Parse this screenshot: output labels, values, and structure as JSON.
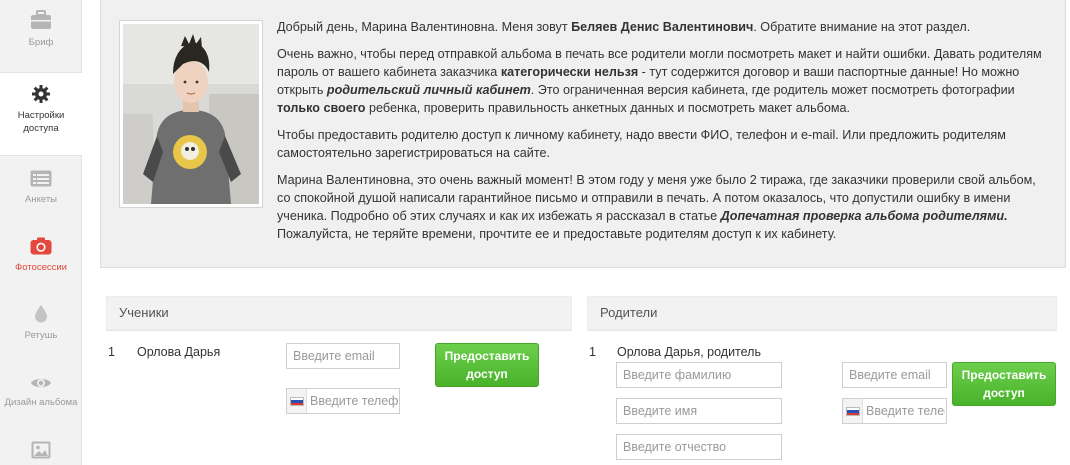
{
  "sidebar": {
    "items": [
      {
        "label": "Бриф",
        "icon": "briefcase-icon"
      },
      {
        "label": "Настройки доступа",
        "icon": "gear-icon"
      },
      {
        "label": "Анкеты",
        "icon": "list-icon"
      },
      {
        "label": "Фотосессии",
        "icon": "camera-icon"
      },
      {
        "label": "Ретушь",
        "icon": "drop-icon"
      },
      {
        "label": "Дизайн альбома",
        "icon": "eye-icon"
      },
      {
        "label": "",
        "icon": "image-icon"
      }
    ],
    "accent_color": "#e2483d"
  },
  "info": {
    "p1_a": "Добрый день, Марина Валентиновна. Меня зовут ",
    "p1_b": "Беляев Денис Валентинович",
    "p1_c": ". Обратите внимание на этот раздел.",
    "p2_a": "Очень важно, чтобы перед отправкой альбома в печать все родители могли посмотреть макет и найти ошибки. Давать родителям пароль от вашего кабинета заказчика ",
    "p2_b": "категорически нельзя",
    "p2_c": " - тут содержится договор и ваши паспортные данные! Но можно открыть ",
    "p2_d": "родительский личный кабинет",
    "p2_e": ". Это ограниченная версия кабинета, где родитель может посмотреть фотографии ",
    "p2_f": "только своего",
    "p2_g": " ребенка, проверить правильность анкетных данных и посмотреть макет альбома.",
    "p3": "Чтобы предоставить родителю доступ к личному кабинету, надо ввести ФИО, телефон и e-mail. Или предложить родителям самостоятельно зарегистрироваться на сайте.",
    "p4_a": "Марина Валентиновна, это очень важный момент! В этом году у меня уже было 2 тиража, где заказчики проверили свой альбом, со спокойной душой написали гарантийное письмо и отправили в печать. А потом оказалось, что допустили ошибку в имени ученика. Подробно об этих случаях и как их избежать я рассказал в статье ",
    "p4_b": "Допечатная проверка альбома родителями.",
    "p4_c": " Пожалуйста, не теряйте времени, прочтите ее и предоставьте родителям доступ к их кабинету."
  },
  "students": {
    "header": "Ученики",
    "rows": [
      {
        "num": "1",
        "name": "Орлова Дарья",
        "email_placeholder": "Введите email",
        "phone_placeholder": "Введите телефон",
        "button": "Предоставить доступ"
      }
    ]
  },
  "parents": {
    "header": "Родители",
    "rows": [
      {
        "num": "1",
        "name": "Орлова Дарья, родитель",
        "surname_placeholder": "Введите фамилию",
        "firstname_placeholder": "Введите имя",
        "patronymic_placeholder": "Введите отчество",
        "email_placeholder": "Введите email",
        "phone_placeholder": "Введите телефон",
        "button": "Предоставить доступ"
      }
    ]
  },
  "colors": {
    "button_green": "#52b935",
    "panel_bg": "#f0f0f0"
  }
}
